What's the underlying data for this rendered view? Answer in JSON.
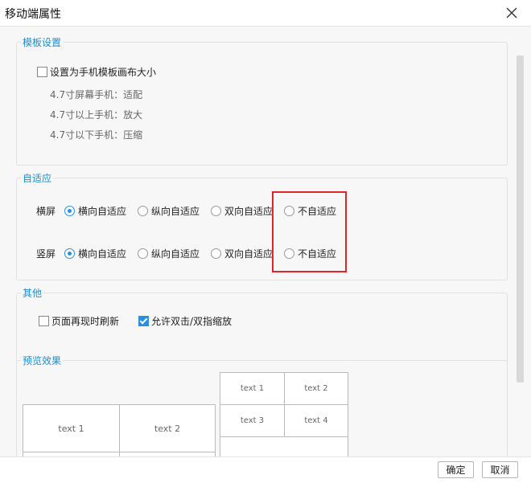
{
  "window": {
    "title": "移动端属性",
    "close_icon": "close-icon"
  },
  "template": {
    "title": "模板设置",
    "checkbox_label": "设置为手机模板画布大小",
    "checked": false,
    "hints": [
      "4.7寸屏幕手机：适配",
      "4.7寸以上手机：放大",
      "4.7寸以下手机：压缩"
    ]
  },
  "adaptive": {
    "title": "自适应",
    "rows": [
      {
        "label": "横屏",
        "options": [
          "横向自适应",
          "纵向自适应",
          "双向自适应",
          "不自适应"
        ],
        "selected": 0
      },
      {
        "label": "竖屏",
        "options": [
          "横向自适应",
          "纵向自适应",
          "双向自适应",
          "不自适应"
        ],
        "selected": 0
      }
    ]
  },
  "other": {
    "title": "其他",
    "options": [
      {
        "label": "页面再现时刷新",
        "checked": false
      },
      {
        "label": "允许双击/双指缩放",
        "checked": true
      }
    ]
  },
  "preview": {
    "title": "预览效果",
    "table_small": [
      "text 1",
      "text 2",
      "text 3",
      "text 4"
    ],
    "table_large": [
      "text 1",
      "text 2"
    ]
  },
  "footer": {
    "ok_label": "确定",
    "cancel_label": "取消"
  },
  "colors": {
    "accent": "#1a8fd6",
    "highlight": "#e0262a"
  }
}
